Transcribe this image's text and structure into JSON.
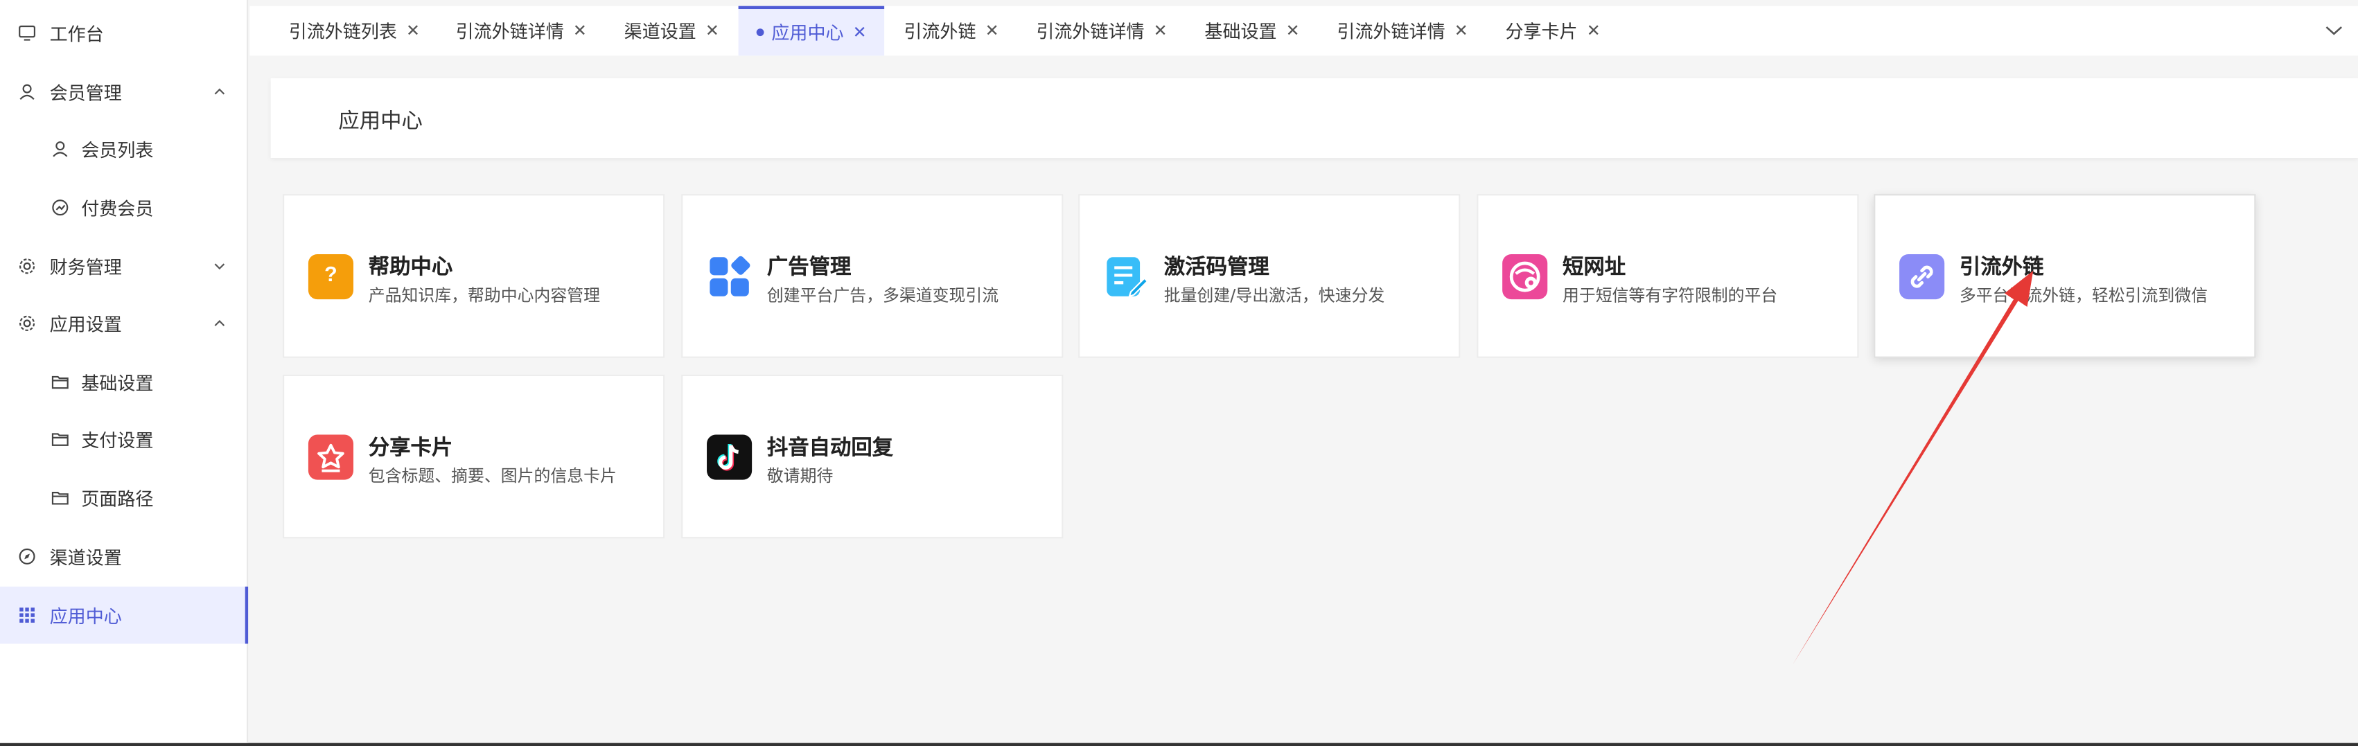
{
  "sidebar": {
    "items": [
      {
        "label": "工作台"
      },
      {
        "label": "会员管理"
      },
      {
        "label": "会员列表"
      },
      {
        "label": "付费会员"
      },
      {
        "label": "财务管理"
      },
      {
        "label": "应用设置"
      },
      {
        "label": "基础设置"
      },
      {
        "label": "支付设置"
      },
      {
        "label": "页面路径"
      },
      {
        "label": "渠道设置"
      },
      {
        "label": "应用中心"
      }
    ]
  },
  "tabs": [
    {
      "label": "引流外链列表"
    },
    {
      "label": "引流外链详情"
    },
    {
      "label": "渠道设置"
    },
    {
      "label": "应用中心"
    },
    {
      "label": "引流外链"
    },
    {
      "label": "引流外链详情"
    },
    {
      "label": "基础设置"
    },
    {
      "label": "引流外链详情"
    },
    {
      "label": "分享卡片"
    }
  ],
  "page": {
    "title": "应用中心"
  },
  "apps": [
    {
      "title": "帮助中心",
      "desc": "产品知识库，帮助中心内容管理",
      "color": "#f59e0b"
    },
    {
      "title": "广告管理",
      "desc": "创建平台广告，多渠道变现引流",
      "color": "#3b82f6"
    },
    {
      "title": "激活码管理",
      "desc": "批量创建/导出激活，快速分发",
      "color": "#38bdf8"
    },
    {
      "title": "短网址",
      "desc": "用于短信等有字符限制的平台",
      "color": "#ec4899"
    },
    {
      "title": "引流外链",
      "desc": "多平台引流外链，轻松引流到微信",
      "color": "#8b8cf7"
    },
    {
      "title": "分享卡片",
      "desc": "包含标题、摘要、图片的信息卡片",
      "color": "#f05252"
    },
    {
      "title": "抖音自动回复",
      "desc": "敬请期待",
      "color": "#111111"
    }
  ],
  "colors": {
    "accent": "#4f5bd5",
    "annotation": "#e53935"
  }
}
